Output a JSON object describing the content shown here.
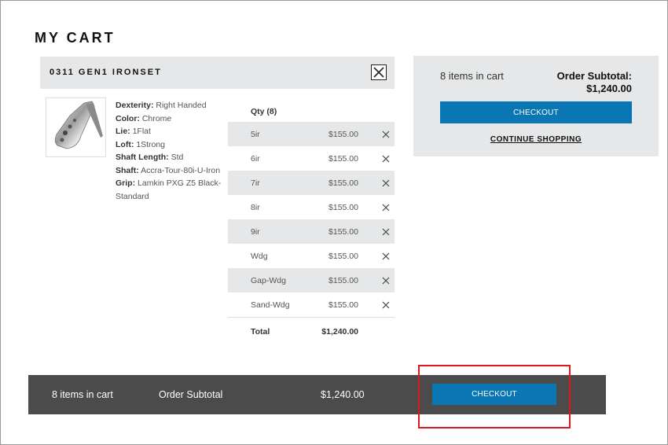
{
  "page": {
    "title": "MY CART"
  },
  "product": {
    "name": "0311 GEN1 IRONSET",
    "image_alt": "iron club head",
    "specs": [
      {
        "label": "Dexterity:",
        "value": "Right Handed"
      },
      {
        "label": "Color:",
        "value": "Chrome"
      },
      {
        "label": "Lie:",
        "value": "1Flat"
      },
      {
        "label": "Loft:",
        "value": "1Strong"
      },
      {
        "label": "Shaft Length:",
        "value": "Std"
      },
      {
        "label": "Shaft:",
        "value": "Accra-Tour-80i-U-Iron"
      },
      {
        "label": "Grip:",
        "value": "Lamkin PXG Z5 Black- Standard"
      }
    ],
    "qty_header": "Qty (8)",
    "items": [
      {
        "name": "5ir",
        "price": "$155.00"
      },
      {
        "name": "6ir",
        "price": "$155.00"
      },
      {
        "name": "7ir",
        "price": "$155.00"
      },
      {
        "name": "8ir",
        "price": "$155.00"
      },
      {
        "name": "9ir",
        "price": "$155.00"
      },
      {
        "name": "Wdg",
        "price": "$155.00"
      },
      {
        "name": "Gap-Wdg",
        "price": "$155.00"
      },
      {
        "name": "Sand-Wdg",
        "price": "$155.00"
      }
    ],
    "total_label": "Total",
    "total_value": "$1,240.00"
  },
  "summary": {
    "count": "8 items in cart",
    "subtotal_label": "Order Subtotal:",
    "subtotal_value": "$1,240.00",
    "checkout_label": "CHECKOUT",
    "continue_label": "CONTINUE SHOPPING"
  },
  "bottom_bar": {
    "count": "8 items in cart",
    "subtotal_label": "Order Subtotal",
    "subtotal_value": "$1,240.00",
    "checkout_label": "CHECKOUT"
  },
  "colors": {
    "accent": "#0a77b4",
    "panel": "#e6e7e8",
    "bar": "#4b4b4b",
    "highlight": "#e0161b"
  }
}
